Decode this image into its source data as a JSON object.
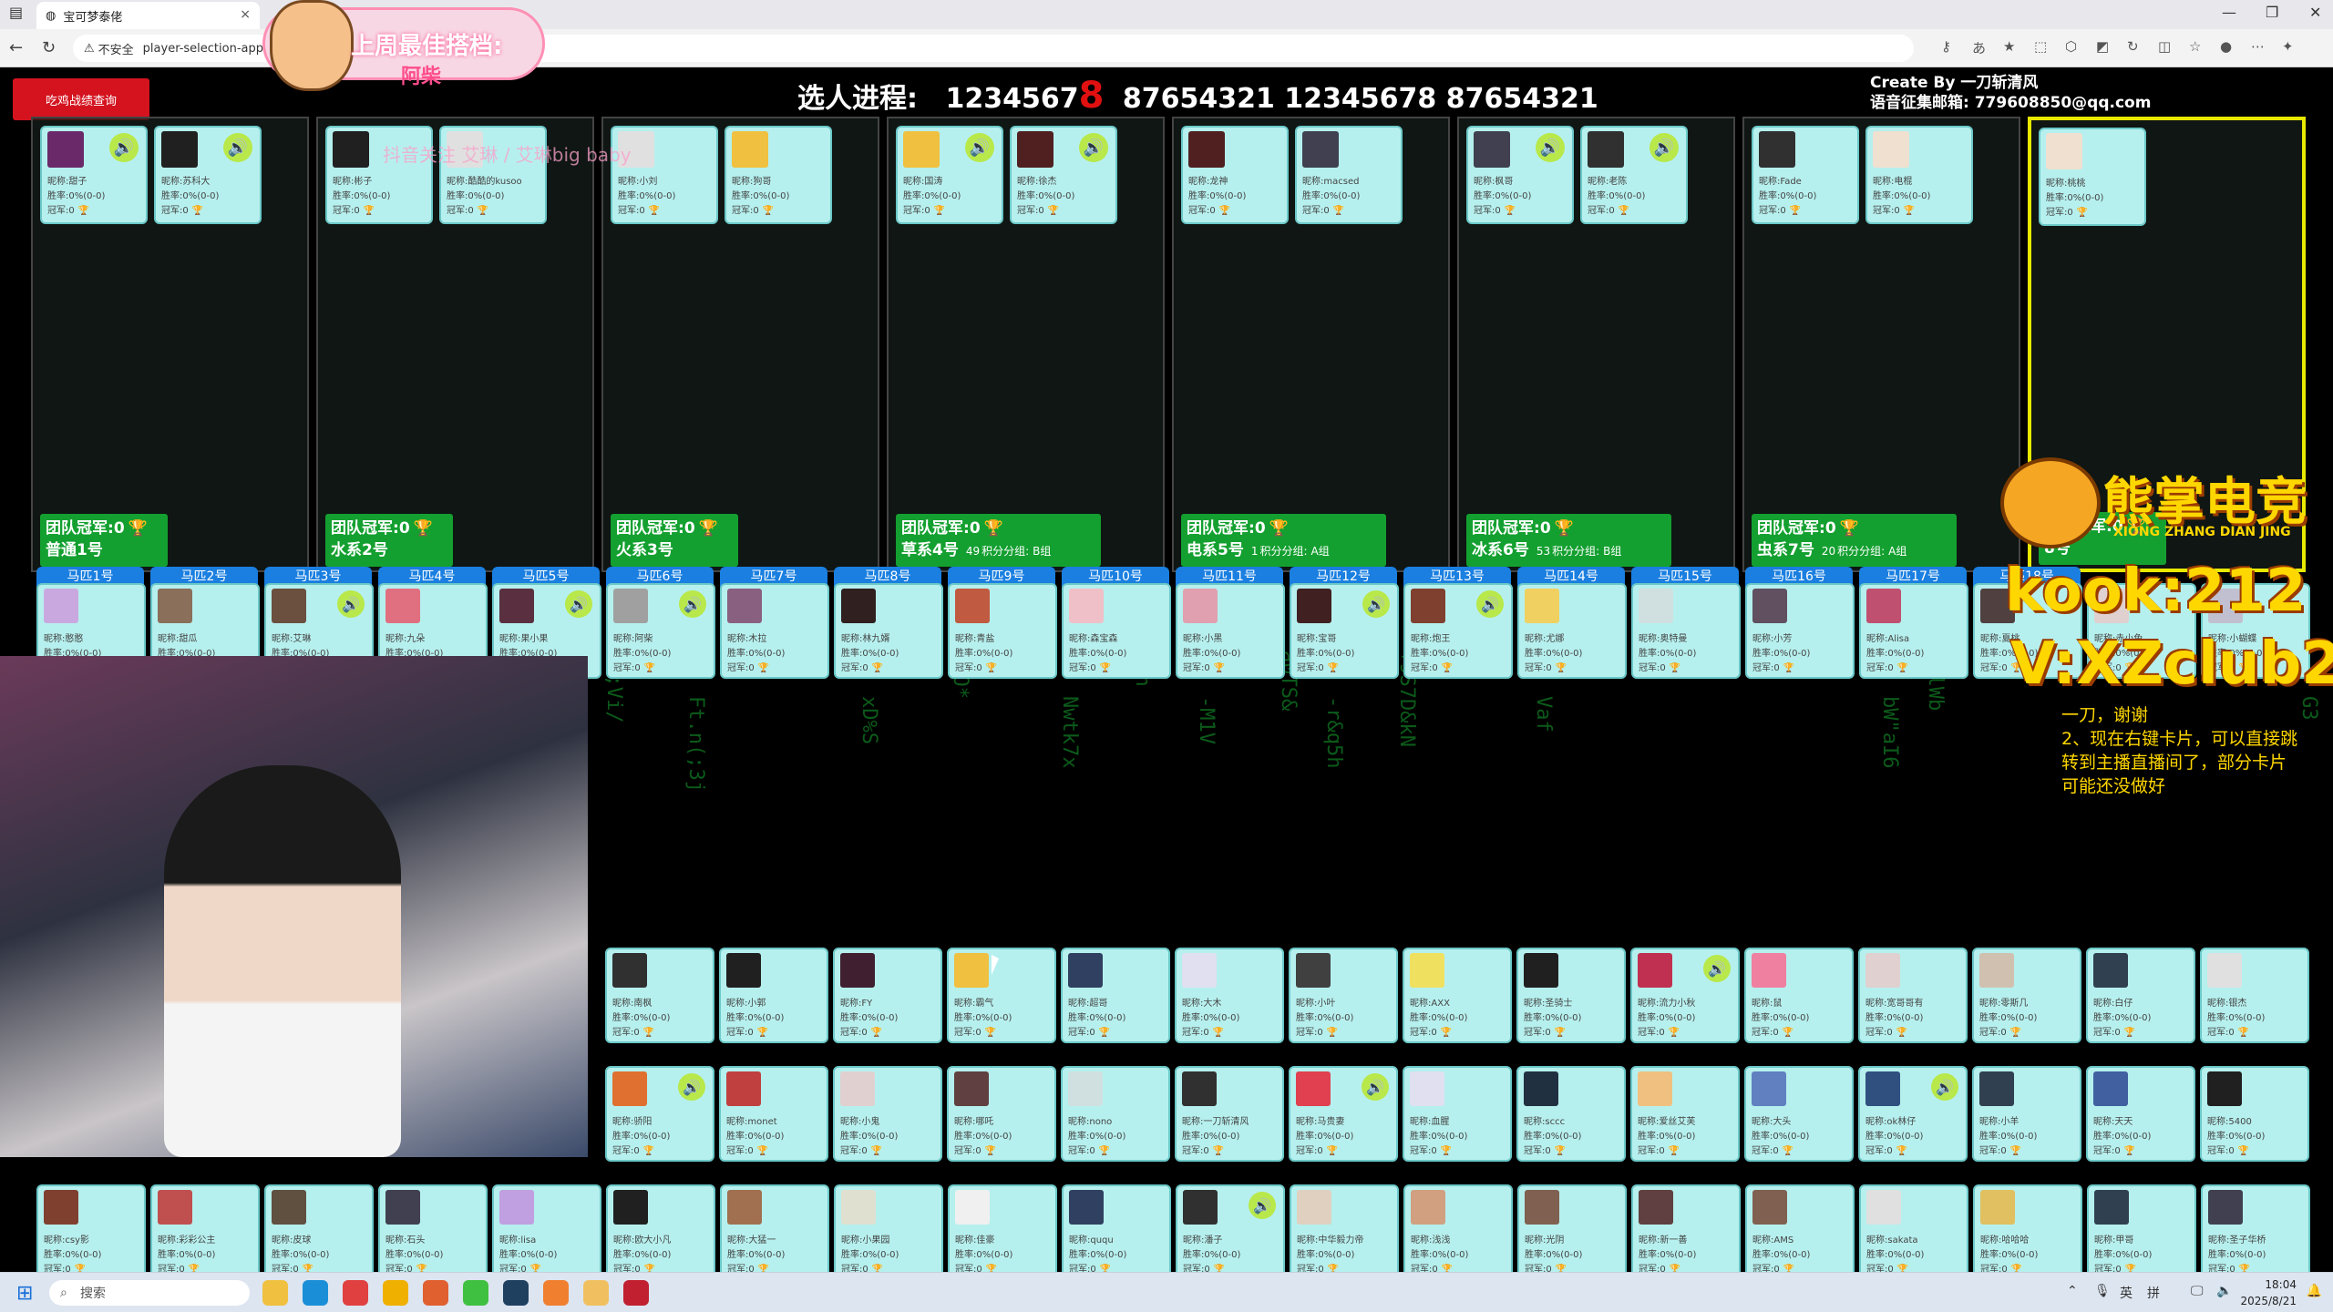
{
  "browser": {
    "tab_title": "宝可梦泰佬",
    "security_label": "不安全",
    "url": "player-selection-app-4",
    "close_glyph": "×",
    "window_controls": [
      "—",
      "❐",
      "✕"
    ],
    "toolbar_icons": [
      "key-icon",
      "translate-icon",
      "star-icon",
      "tab-icon",
      "extension-icon",
      "outlook-icon",
      "refresh-icon",
      "split-icon",
      "favorites-icon",
      "profile-icon",
      "more-icon",
      "copilot-icon"
    ]
  },
  "overlay_banner": {
    "title": "上周最佳搭档:",
    "subtitle": "阿柴"
  },
  "page": {
    "query_button": "吃鸡战绩查询",
    "progress_label": "选人进程:",
    "progress_seq_a": "1234567",
    "progress_highlight": "8",
    "progress_seq_b": "87654321 12345678 87654321",
    "credit_line1": "Create By 一刀斩清风",
    "credit_line2": "语音征集邮箱: 779608850@qq.com",
    "watermark": "抖音关注 艾琳 / 艾琳big baby"
  },
  "labels": {
    "nick": "昵称:",
    "win": "胜率:",
    "champ": "冠军:",
    "team_champ": "团队冠军:",
    "score": "积分分组:"
  },
  "teams": [
    {
      "name": "普通1号",
      "champ": "0",
      "group": "",
      "players": [
        {
          "nick": "甜子",
          "win": "0%(0-0)",
          "champ": "0",
          "voice": true
        },
        {
          "nick": "苏科大",
          "win": "0%(0-0)",
          "champ": "0",
          "voice": true
        }
      ]
    },
    {
      "name": "水系2号",
      "champ": "0",
      "group": "",
      "players": [
        {
          "nick": "彬子",
          "win": "0%(0-0)",
          "champ": "0",
          "voice": false
        },
        {
          "nick": "酷酷的kusoo",
          "win": "0%(0-0)",
          "champ": "0",
          "voice": false
        }
      ]
    },
    {
      "name": "火系3号",
      "champ": "0",
      "group": "",
      "players": [
        {
          "nick": "小刘",
          "win": "0%(0-0)",
          "champ": "0",
          "voice": false
        },
        {
          "nick": "狗哥",
          "win": "0%(0-0)",
          "champ": "0",
          "voice": false
        }
      ]
    },
    {
      "name": "草系4号",
      "champ": "0",
      "group": "B组",
      "score": "49",
      "players": [
        {
          "nick": "国涛",
          "win": "0%(0-0)",
          "champ": "0",
          "voice": true
        },
        {
          "nick": "徐杰",
          "win": "0%(0-0)",
          "champ": "0",
          "voice": true
        }
      ]
    },
    {
      "name": "电系5号",
      "champ": "0",
      "group": "A组",
      "score": "1",
      "players": [
        {
          "nick": "龙神",
          "win": "0%(0-0)",
          "champ": "0",
          "voice": false
        },
        {
          "nick": "macsed",
          "win": "0%(0-0)",
          "champ": "0",
          "voice": false
        }
      ]
    },
    {
      "name": "冰系6号",
      "champ": "0",
      "group": "B组",
      "score": "53",
      "players": [
        {
          "nick": "枫哥",
          "win": "0%(0-0)",
          "champ": "0",
          "voice": true
        },
        {
          "nick": "老陈",
          "win": "0%(0-0)",
          "champ": "0",
          "voice": true
        }
      ]
    },
    {
      "name": "虫系7号",
      "champ": "0",
      "group": "A组",
      "score": "20",
      "players": [
        {
          "nick": "Fade",
          "win": "0%(0-0)",
          "champ": "0",
          "voice": false
        },
        {
          "nick": "电棍",
          "win": "0%(0-0)",
          "champ": "0",
          "voice": false
        }
      ]
    },
    {
      "name": "8号",
      "champ": "0",
      "group": "",
      "players": [
        {
          "nick": "桃桃",
          "win": "0%(0-0)",
          "champ": "0",
          "voice": false
        }
      ]
    }
  ],
  "horses": [
    "马匹1号",
    "马匹2号",
    "马匹3号",
    "马匹4号",
    "马匹5号",
    "马匹6号",
    "马匹7号",
    "马匹8号",
    "马匹9号",
    "马匹10号",
    "马匹11号",
    "马匹12号",
    "马匹13号",
    "马匹14号",
    "马匹15号",
    "马匹16号",
    "马匹17号",
    "马匹18号"
  ],
  "horse_players": [
    {
      "nick": "憨憨",
      "win": "0%(0-0)",
      "champ": "0",
      "voice": false,
      "c": "#c9a8e0"
    },
    {
      "nick": "甜瓜",
      "win": "0%(0-0)",
      "champ": "0",
      "voice": false,
      "c": "#8a6f5a"
    },
    {
      "nick": "艾琳",
      "win": "0%(0-0)",
      "champ": "0",
      "voice": true,
      "c": "#6b5040"
    },
    {
      "nick": "九朵",
      "win": "0%(0-0)",
      "champ": "0",
      "voice": false,
      "c": "#e07080"
    },
    {
      "nick": "果小果",
      "win": "0%(0-0)",
      "champ": "0",
      "voice": true,
      "c": "#5a3040"
    },
    {
      "nick": "阿柴",
      "win": "0%(0-0)",
      "champ": "0",
      "voice": true,
      "c": "#a0a0a0"
    },
    {
      "nick": "木拉",
      "win": "0%(0-0)",
      "champ": "0",
      "voice": false,
      "c": "#8a6080"
    },
    {
      "nick": "林九婿",
      "win": "0%(0-0)",
      "champ": "0",
      "voice": false,
      "c": "#302020"
    },
    {
      "nick": "青盐",
      "win": "0%(0-0)",
      "champ": "0",
      "voice": false,
      "c": "#c05a40"
    },
    {
      "nick": "森宝森",
      "win": "0%(0-0)",
      "champ": "0",
      "voice": false,
      "c": "#f0c0c8"
    },
    {
      "nick": "小黑",
      "win": "0%(0-0)",
      "champ": "0",
      "voice": false,
      "c": "#e0a0b0"
    },
    {
      "nick": "宝哥",
      "win": "0%(0-0)",
      "champ": "0",
      "voice": true,
      "c": "#402020"
    },
    {
      "nick": "炮王",
      "win": "0%(0-0)",
      "champ": "0",
      "voice": true,
      "c": "#804030"
    },
    {
      "nick": "尤娜",
      "win": "0%(0-0)",
      "champ": "0",
      "voice": false,
      "c": "#f0d060"
    },
    {
      "nick": "奥特曼",
      "win": "0%(0-0)",
      "champ": "0",
      "voice": false,
      "c": "#d0e0e0"
    },
    {
      "nick": "小芳",
      "win": "0%(0-0)",
      "champ": "0",
      "voice": false,
      "c": "#605060"
    },
    {
      "nick": "Alisa",
      "win": "0%(0-0)",
      "champ": "0",
      "voice": false,
      "c": "#c05070"
    },
    {
      "nick": "夏桃",
      "win": "0%(0-0)",
      "champ": "0",
      "voice": false,
      "c": "#504040"
    },
    {
      "nick": "赤小兔",
      "win": "0%(0-0)",
      "champ": "0",
      "voice": false,
      "c": "#e0d0d0"
    },
    {
      "nick": "小蝴蝶",
      "win": "0%(0-0)",
      "champ": "0",
      "voice": false,
      "c": "#c0c0d0"
    }
  ],
  "pool_rows": [
    [
      {
        "nick": "南枫",
        "c": "#303030"
      },
      {
        "nick": "小郭",
        "c": "#202020"
      },
      {
        "nick": "FY",
        "c": "#402030"
      },
      {
        "nick": "霸气",
        "c": "#f0c040",
        "voice": false
      },
      {
        "nick": "超哥",
        "c": "#304060"
      },
      {
        "nick": "大木",
        "c": "#e0e0f0"
      },
      {
        "nick": "小叶",
        "c": "#404040"
      },
      {
        "nick": "AXX",
        "c": "#f0e060"
      },
      {
        "nick": "圣骑士",
        "c": "#202020"
      },
      {
        "nick": "流力小秋",
        "c": "#c03050",
        "voice": true
      },
      {
        "nick": "鼠",
        "c": "#f080a0"
      },
      {
        "nick": "宽哥哥有",
        "c": "#e0d0d0"
      },
      {
        "nick": "零斯几",
        "c": "#d0c0b0"
      },
      {
        "nick": "白仔",
        "c": "#304050"
      },
      {
        "nick": "银杰",
        "c": "#e0e0e0"
      }
    ],
    [
      {
        "nick": "骄阳",
        "c": "#e07030",
        "voice": true
      },
      {
        "nick": "monet",
        "c": "#c04040"
      },
      {
        "nick": "小鬼",
        "c": "#e0d0d0"
      },
      {
        "nick": "哪吒",
        "c": "#604040"
      },
      {
        "nick": "nono",
        "c": "#d0e0e0"
      },
      {
        "nick": "一刀斩清风",
        "c": "#303030"
      },
      {
        "nick": "马贵妻",
        "c": "#e04050",
        "voice": true
      },
      {
        "nick": "血腥",
        "c": "#e0e0f0"
      },
      {
        "nick": "sccc",
        "c": "#203040"
      },
      {
        "nick": "爱丝艾芙",
        "c": "#f0c080"
      },
      {
        "nick": "大头",
        "c": "#6080c0"
      },
      {
        "nick": "ok林仔",
        "c": "#305080",
        "voice": true
      },
      {
        "nick": "小羊",
        "c": "#304050"
      },
      {
        "nick": "天天",
        "c": "#4060a0"
      },
      {
        "nick": "5400",
        "c": "#202020"
      }
    ],
    [
      {
        "nick": "csy影",
        "c": "#804030"
      },
      {
        "nick": "彩彩公主",
        "c": "#c05050"
      },
      {
        "nick": "皮球",
        "c": "#605040"
      },
      {
        "nick": "石头",
        "c": "#404050"
      },
      {
        "nick": "lisa",
        "c": "#c0a0e0"
      },
      {
        "nick": "欧大小凡",
        "c": "#202020"
      },
      {
        "nick": "大猛一",
        "c": "#a07050"
      },
      {
        "nick": "小果园",
        "c": "#e0e0d0"
      },
      {
        "nick": "佳豪",
        "c": "#f0f0f0"
      },
      {
        "nick": "ququ",
        "c": "#304060"
      },
      {
        "nick": "潘子",
        "c": "#303030",
        "voice": true
      },
      {
        "nick": "中华毅力帝",
        "c": "#e0d0c0"
      },
      {
        "nick": "浅浅",
        "c": "#d0a080"
      },
      {
        "nick": "光阴",
        "c": "#806050"
      },
      {
        "nick": "新一善",
        "c": "#604040"
      },
      {
        "nick": "AMS",
        "c": "#806050"
      },
      {
        "nick": "sakata",
        "c": "#e0e0e0"
      },
      {
        "nick": "哈哈哈",
        "c": "#e0c060"
      },
      {
        "nick": "甲哥",
        "c": "#304050"
      },
      {
        "nick": "圣子华桥",
        "c": "#404050"
      }
    ]
  ],
  "branding": {
    "brand_cn": "熊掌电竞",
    "brand_en": "XIONG ZHANG DIAN JING",
    "kook": "kook:212",
    "vx": "V:XZclub212",
    "note": "一刀，谢谢\n2、现在右键卡片，可以直接跳转到主播直播间了，部分卡片可能还没做好"
  },
  "taskbar": {
    "search_placeholder": "搜索",
    "ime_1": "英",
    "ime_2": "拼",
    "time": "18:04",
    "date": "2025/8/21"
  },
  "colors": {
    "card_bg": "#b6f0ee",
    "team_label": "#14a030",
    "horse_tab": "#1a7fe0",
    "accent_red": "#d4131f",
    "brand_gold": "#ffd700",
    "active_border": "#e8e800"
  }
}
